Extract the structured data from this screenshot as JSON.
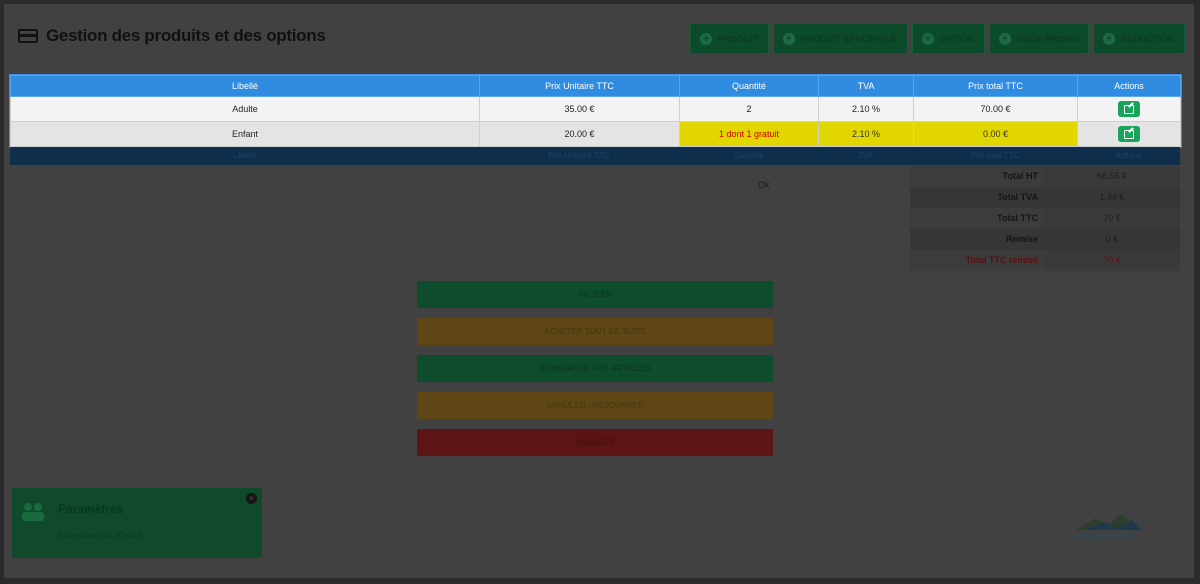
{
  "header": {
    "title": "Gestion des produits et des options"
  },
  "top_buttons": [
    "PRODUIT",
    "PRODUIT SPECIFIQUE",
    "OPTION",
    "CODE PROMO",
    "REDUCTION"
  ],
  "table": {
    "headers": [
      "Libellé",
      "Prix Unitaire TTC",
      "Quantité",
      "TVA",
      "Prix total TTC",
      "Actions"
    ],
    "rows": [
      [
        "Adulte",
        "35.00 €",
        "2",
        "2.10 %",
        "70.00 €"
      ],
      [
        "Enfant",
        "20.00 €",
        "1 dont 1 gratuit",
        "2.10 %",
        "0.00 €"
      ]
    ]
  },
  "footer_headers": [
    "Libellé",
    "Prix Unitaire TTC",
    "Quantité",
    "TVA",
    "Prix total TTC",
    "Actions"
  ],
  "totals": {
    "labels": [
      "Total HT",
      "Total TVA",
      "Total TTC",
      "Remise",
      "Total TTC remisé"
    ],
    "values": [
      "68.56 €",
      "1.44 €",
      "70 €",
      "0 €",
      "70 €"
    ]
  },
  "small_mark": "Ok",
  "action_buttons": [
    "VALIDER",
    "ACHETER TOUT DE SUITE",
    "CONSERVER VOS ARTICLES",
    "ANNULER - RETOURNER",
    "ANNULER"
  ],
  "notification": {
    "title": "Paramètres",
    "message": "Enregistrement effectué"
  },
  "logo": {
    "text": "RESACTIVITE"
  },
  "colors": {
    "header_blue": "#2f8ce0",
    "highlight_yellow": "#e2d600",
    "edit_green": "#18a45a"
  }
}
